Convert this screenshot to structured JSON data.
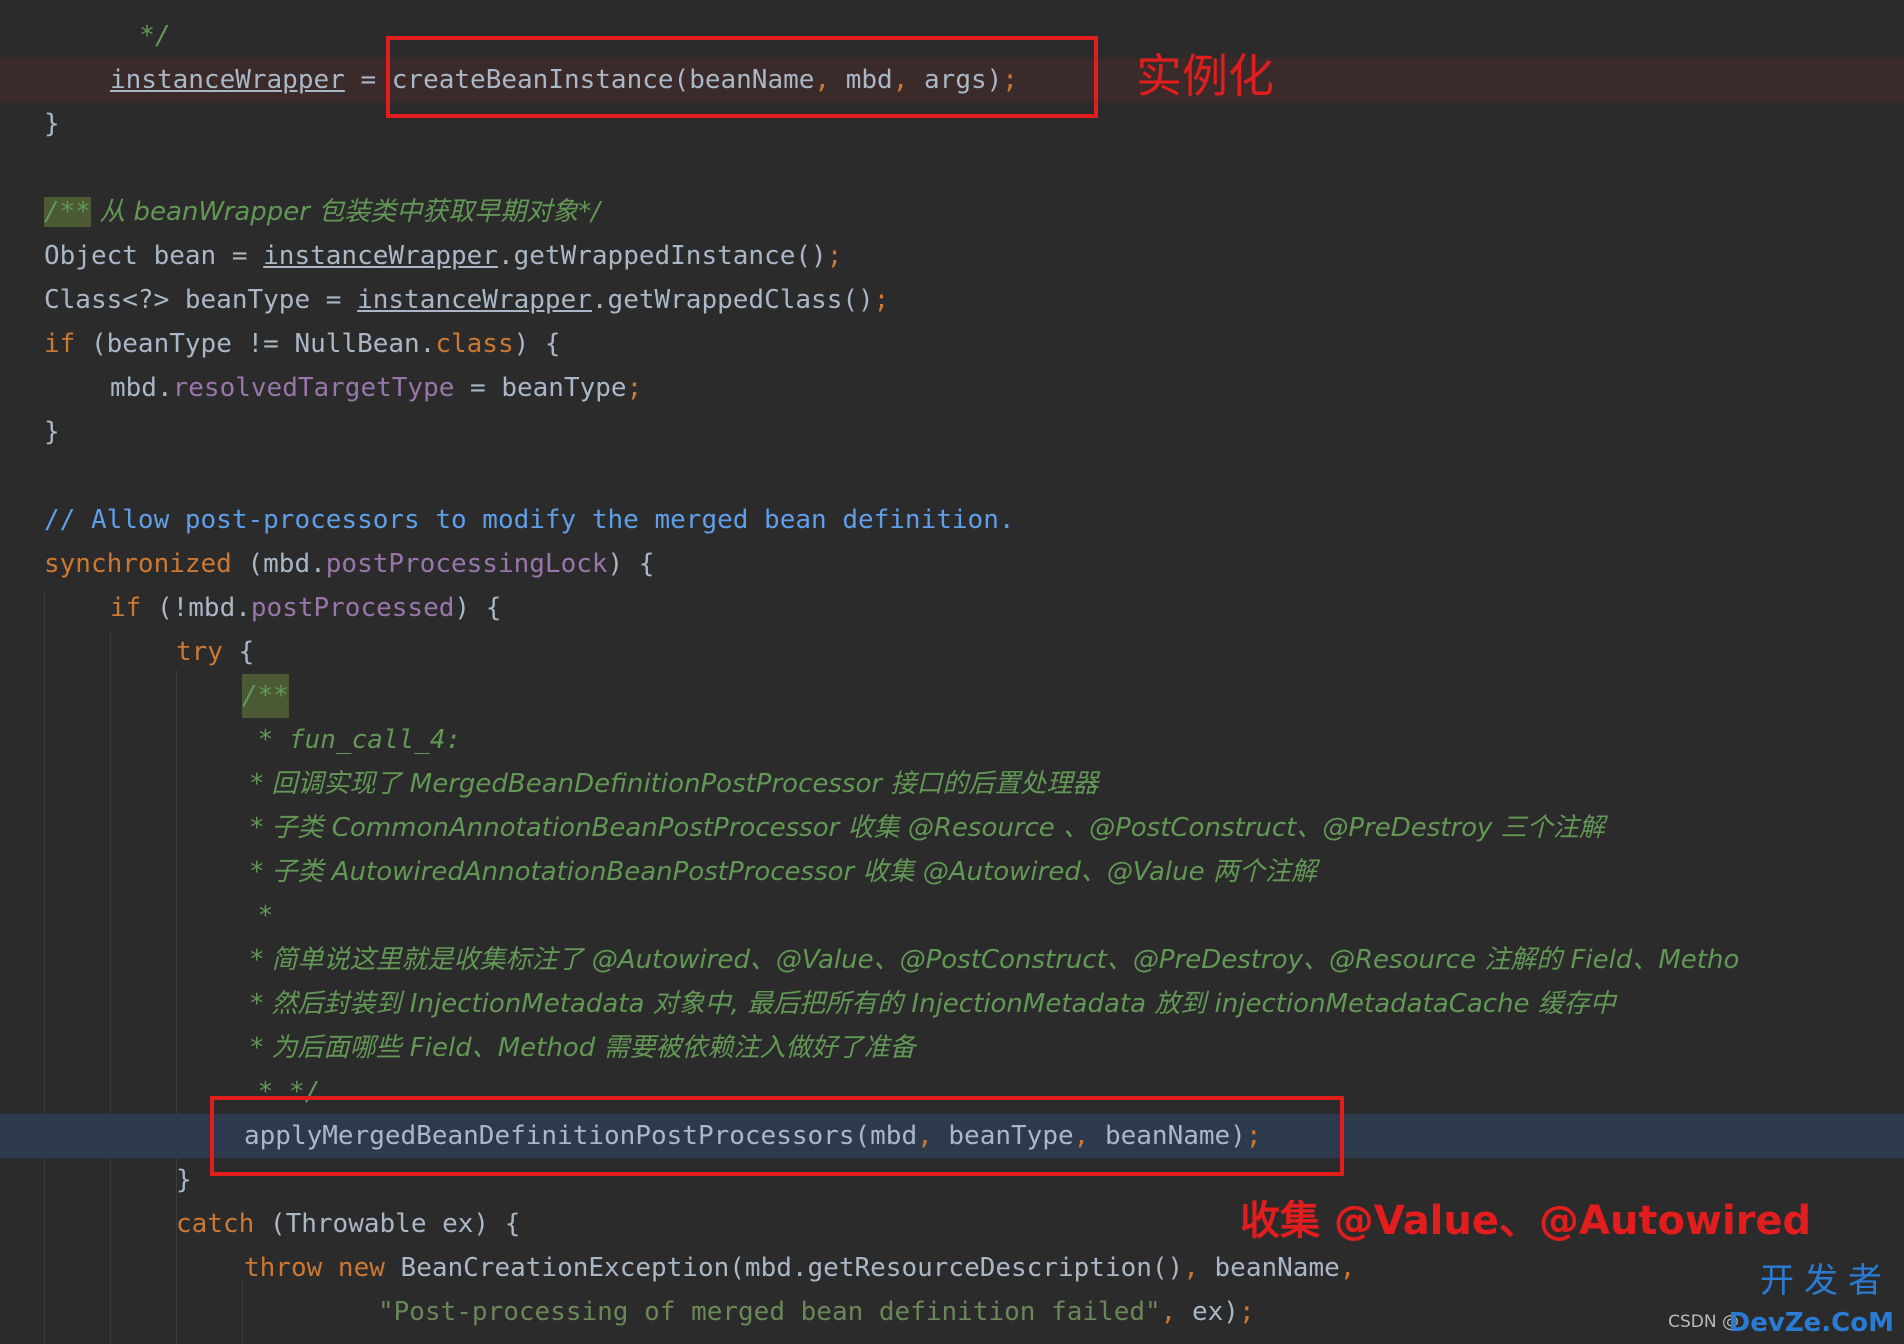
{
  "lines": {
    "l0": "  */",
    "l1_a": "instanceWrapper",
    "l1_b": " = ",
    "l1_c": "createBeanInstance(beanName",
    "l1_d": ", ",
    "l1_e": "mbd",
    "l1_f": ", ",
    "l1_g": "args)",
    "l1_h": ";",
    "l2": "}",
    "l3_open": "/**",
    "l3_rest": " 从 beanWrapper 包装类中获取早期对象*/",
    "l4_a": "Object bean = ",
    "l4_b": "instanceWrapper",
    "l4_c": ".getWrappedInstance()",
    "l4_d": ";",
    "l5_a": "Class<?> beanType = ",
    "l5_b": "instanceWrapper",
    "l5_c": ".getWrappedClass()",
    "l5_d": ";",
    "l6_a": "if",
    "l6_b": " (beanType != NullBean.",
    "l6_c": "class",
    "l6_d": ") {",
    "l7_a": "mbd.",
    "l7_b": "resolvedTargetType",
    "l7_c": " = beanType",
    "l7_d": ";",
    "l8": "}",
    "l9": "// Allow post-processors to modify the merged bean definition.",
    "l10_a": "synchronized",
    "l10_b": " (mbd.",
    "l10_c": "postProcessingLock",
    "l10_d": ") {",
    "l11_a": "if",
    "l11_b": " (!mbd.",
    "l11_c": "postProcessed",
    "l11_d": ") {",
    "l12_a": "try",
    "l12_b": " {",
    "l13": "/**",
    "l14": " * fun_call_4:",
    "l15": " * 回调实现了 MergedBeanDefinitionPostProcessor 接口的后置处理器",
    "l16": " * 子类 CommonAnnotationBeanPostProcessor 收集 @Resource 、@PostConstruct、@PreDestroy 三个注解",
    "l17": " * 子类 AutowiredAnnotationBeanPostProcessor 收集 @Autowired、@Value 两个注解",
    "l18": " *",
    "l19": " * 简单说这里就是收集标注了 @Autowired、@Value、@PostConstruct、@PreDestroy、@Resource 注解的 Field、Metho",
    "l20": " * 然后封装到 InjectionMetadata 对象中, 最后把所有的 InjectionMetadata 放到 injectionMetadataCache 缓存中",
    "l21": " * 为后面哪些 Field、Method 需要被依赖注入做好了准备",
    "l22": " * */",
    "l23_a": "applyMergedBeanDefinitionPostProcessors(mbd",
    "l23_b": ", ",
    "l23_c": "beanType",
    "l23_d": ", ",
    "l23_e": "beanName)",
    "l23_f": ";",
    "l24": "}",
    "l25_a": "catch",
    "l25_b": " (Throwable ex) {",
    "l26_a": "throw new",
    "l26_b": " BeanCreationException(mbd.getResourceDescription()",
    "l26_c": ", ",
    "l26_d": "beanName",
    "l26_e": ",",
    "l27_a": "\"Post-processing of merged bean definition failed\"",
    "l27_b": ", ",
    "l27_c": "ex)",
    "l27_d": ";"
  },
  "annotations": {
    "instantiate": "实例化",
    "collect": "收集 @Value、@Autowired"
  },
  "watermark": {
    "cn": "开发者",
    "en": "DevZe.CoM",
    "csdn": "CSDN @"
  },
  "colors": {
    "background": "#2b2b2b",
    "keyword": "#cc7832",
    "field": "#9876aa",
    "string": "#6a8759",
    "doc_comment": "#629755",
    "line_comment": "#5f9ee8",
    "annotation_red": "#e11d1d"
  }
}
